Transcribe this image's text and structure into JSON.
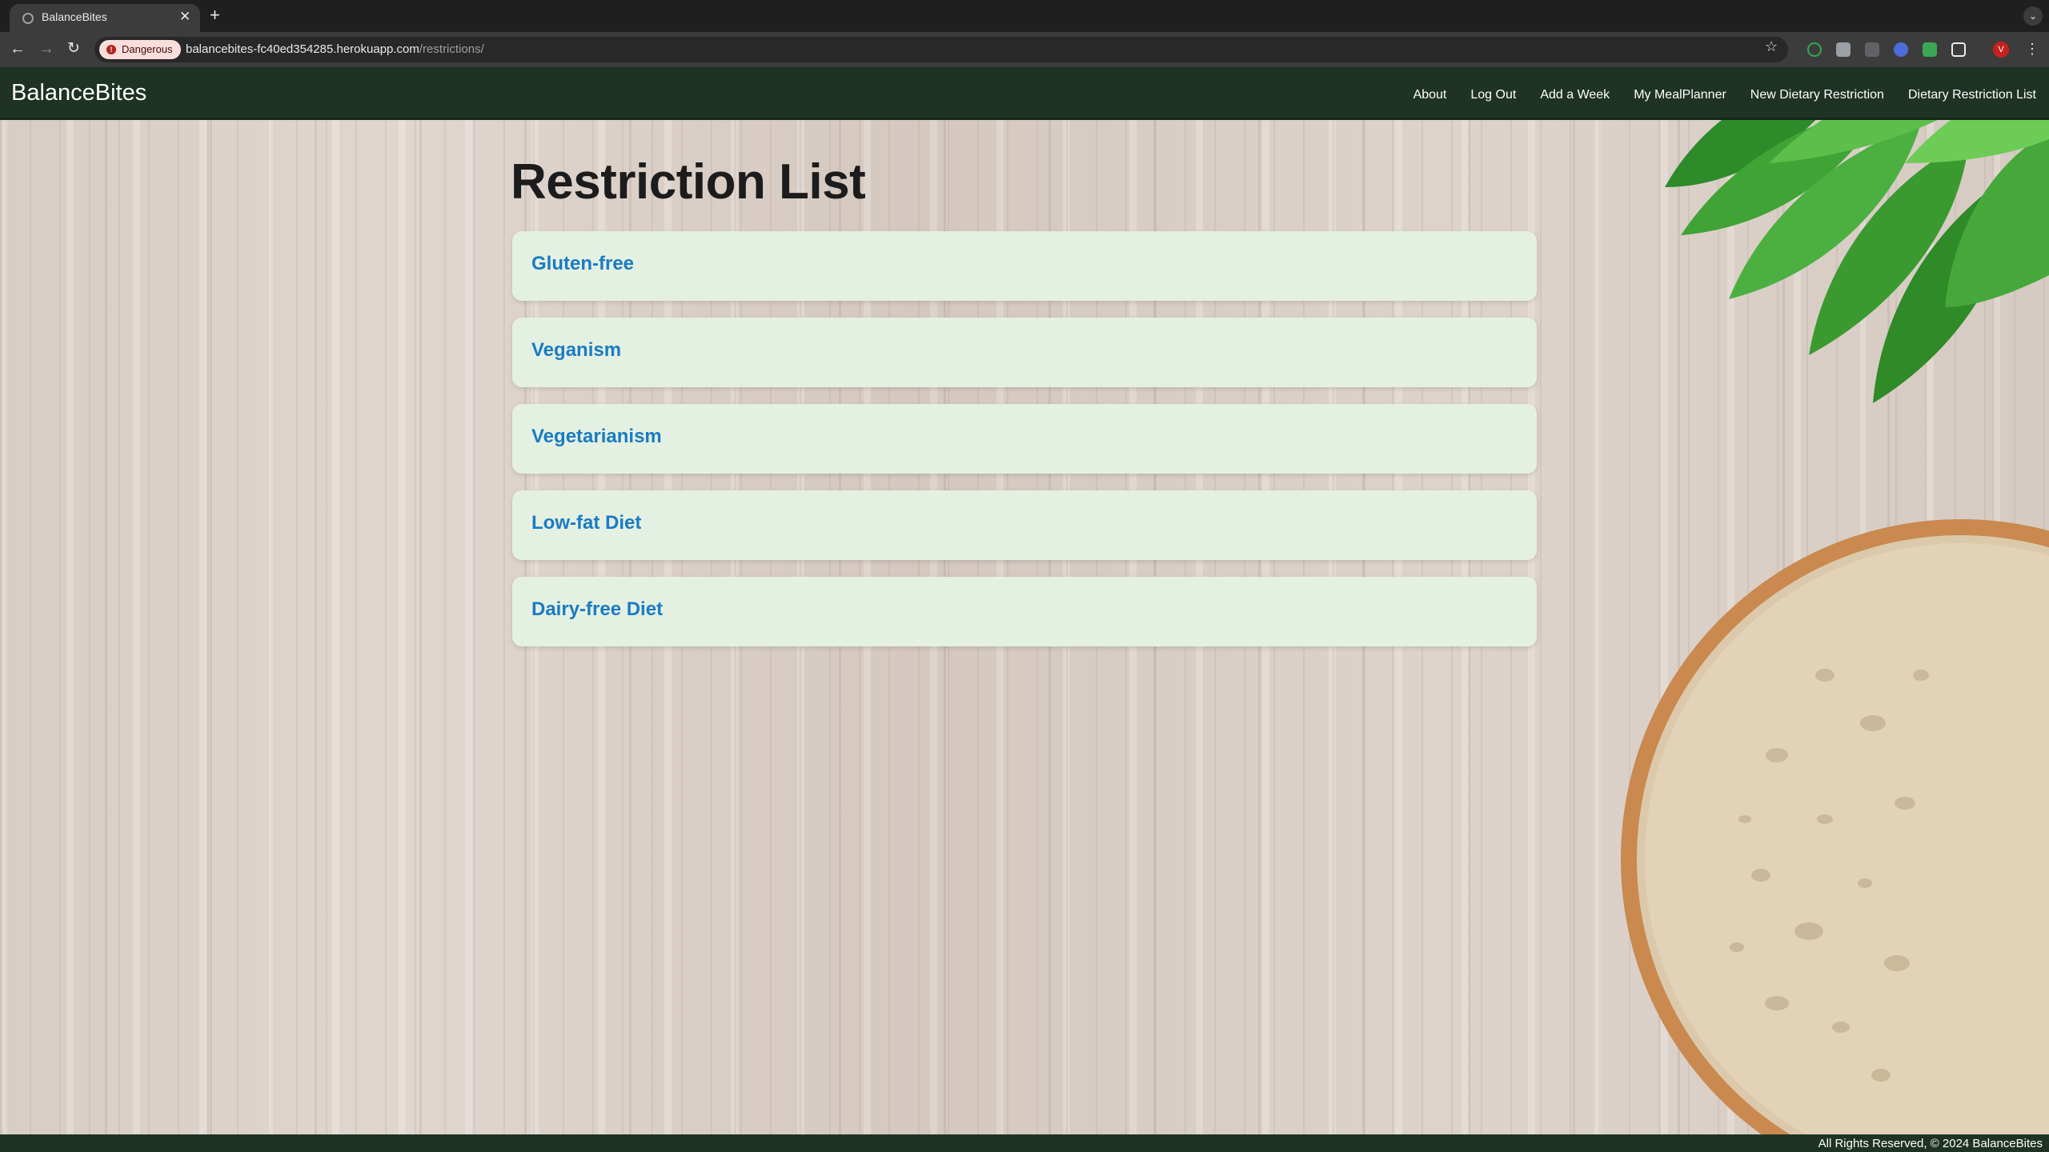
{
  "browser": {
    "tab_title": "BalanceBites",
    "tab_close": "✕",
    "new_tab": "+",
    "security_chip": "Dangerous",
    "url_host": "balancebites-fc40ed354285.herokuapp.com",
    "url_path": "/restrictions/",
    "profile_initial": "V"
  },
  "navbar": {
    "brand": "BalanceBites",
    "links": [
      "About",
      "Log Out",
      "Add a Week",
      "My MealPlanner",
      "New Dietary Restriction",
      "Dietary Restriction List"
    ]
  },
  "main": {
    "title": "Restriction List",
    "restrictions": [
      "Gluten-free",
      "Veganism",
      "Vegetarianism",
      "Low-fat Diet",
      "Dairy-free Diet"
    ]
  },
  "footer": {
    "text": "All Rights Reserved, © 2024 BalanceBites"
  },
  "colors": {
    "navbar_bg": "#1e3324",
    "card_bg": "#e4f1e2",
    "link": "#1a7bc4",
    "danger_chip": "#f9dedc"
  }
}
